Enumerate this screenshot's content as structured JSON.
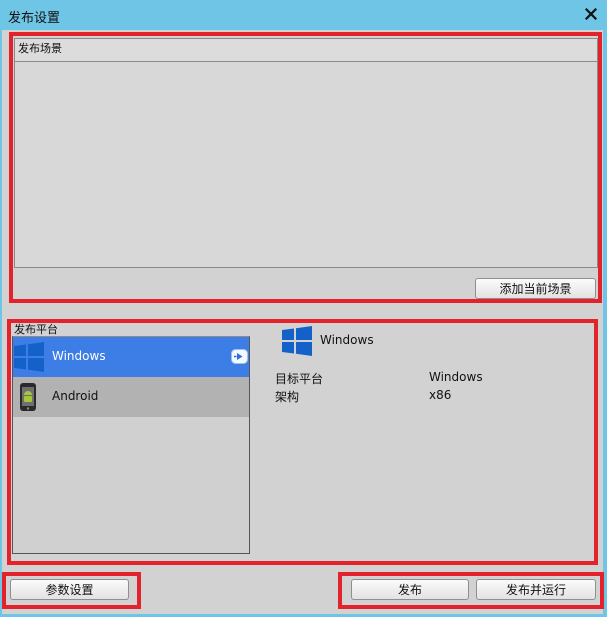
{
  "window": {
    "title": "发布设置"
  },
  "scenes": {
    "header": "发布场景",
    "add_button": "添加当前场景"
  },
  "platforms": {
    "section_label": "发布平台",
    "items": [
      {
        "name": "Windows",
        "selected": true,
        "icon": "windows-logo-icon"
      },
      {
        "name": "Android",
        "selected": false,
        "icon": "android-phone-icon"
      }
    ]
  },
  "detail": {
    "name": "Windows",
    "fields": [
      {
        "key": "目标平台",
        "value": "Windows"
      },
      {
        "key": "架构",
        "value": "x86"
      }
    ]
  },
  "footer": {
    "settings_button": "参数设置",
    "publish_button": "发布",
    "publish_run_button": "发布并运行"
  },
  "colors": {
    "titlebar": "#6ec5e6",
    "selection": "#3d7ee6",
    "highlight_border": "#e3232b",
    "windows_blue": "#1462c9"
  }
}
